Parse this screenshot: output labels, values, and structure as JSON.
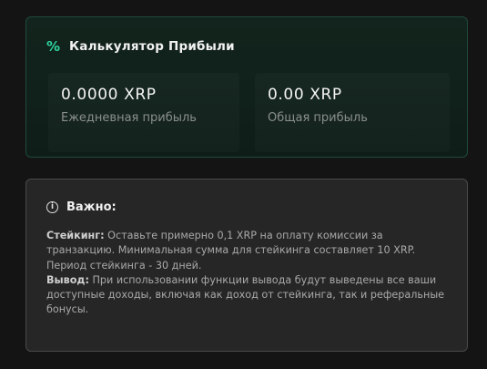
{
  "calculator": {
    "icon": "percent-icon",
    "title": "Калькулятор Прибыли",
    "accent_color": "#2dd4a0",
    "daily": {
      "value": "0.0000 XRP",
      "label": "Ежедневная прибыль"
    },
    "total": {
      "value": "0.00 XRP",
      "label": "Общая прибыль"
    }
  },
  "notice": {
    "icon": "info-icon",
    "title": "Важно:",
    "staking_label": "Стейкинг:",
    "staking_text": " Оставьте примерно 0,1 XRP на оплату комиссии за транзакцию. Минимальная сумма для стейкинга составляет 10 XRP. Период стейкинга - 30 дней.",
    "withdrawal_label": "Вывод:",
    "withdrawal_text": " При использовании функции вывода будут выведены все ваши доступные доходы, включая как доход от стейкинга, так и реферальные бонусы."
  }
}
